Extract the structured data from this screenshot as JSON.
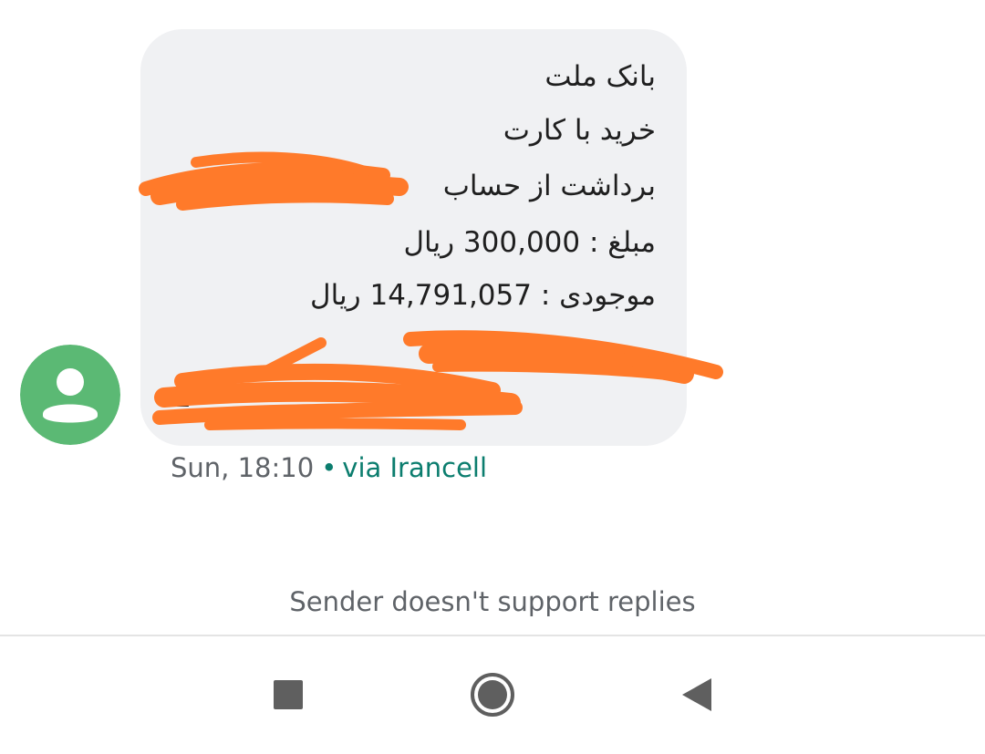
{
  "conversation": {
    "message": {
      "lines": [
        "بانک ملت",
        "خرید با کارت",
        "برداشت از حساب",
        "مبلغ : 300,000 ریال",
        "موجودی : 14,791,057 ریال"
      ],
      "redacted_fragment": "1"
    },
    "meta": {
      "time": "Sun, 18:10",
      "separator": "•",
      "carrier": "via Irancell"
    },
    "reply_notice": "Sender doesn't support replies"
  },
  "colors": {
    "bubble": "#f0f1f3",
    "avatar": "#5bb974",
    "redaction": "#ff7a2a",
    "carrier_accent": "#0b7d6e"
  },
  "icons": {
    "avatar": "person-icon",
    "recents": "square-recents-icon",
    "home": "circle-home-icon",
    "back": "triangle-back-icon"
  }
}
